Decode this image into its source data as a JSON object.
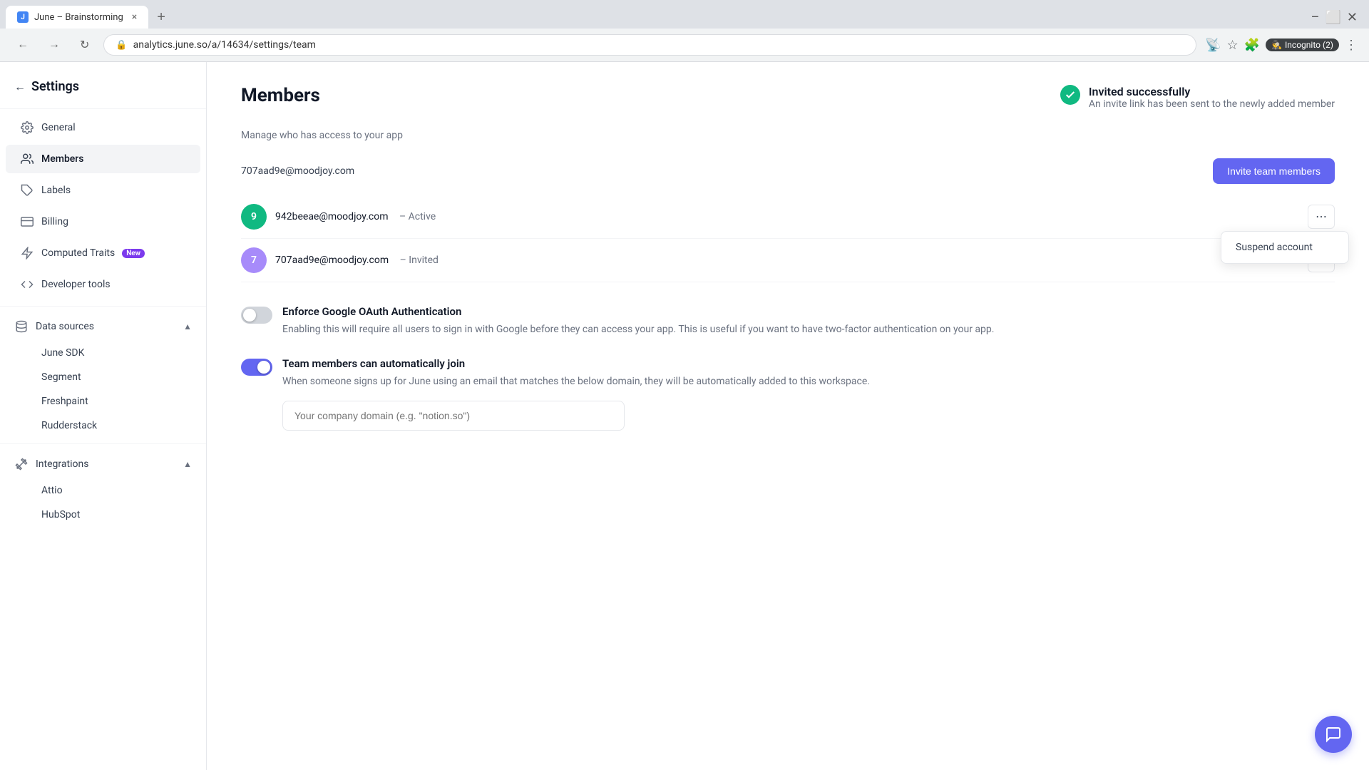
{
  "browser": {
    "tab_title": "June – Brainstorming",
    "tab_close": "×",
    "tab_new": "+",
    "nav_back": "←",
    "nav_forward": "→",
    "nav_refresh": "↻",
    "address": "analytics.june.so/a/14634/settings/team",
    "incognito_label": "Incognito (2)"
  },
  "sidebar": {
    "back_label": "←",
    "title": "Settings",
    "items": [
      {
        "id": "general",
        "label": "General",
        "icon": "gear"
      },
      {
        "id": "members",
        "label": "Members",
        "icon": "users",
        "active": true
      },
      {
        "id": "labels",
        "label": "Labels",
        "icon": "tag"
      },
      {
        "id": "billing",
        "label": "Billing",
        "icon": "credit-card"
      },
      {
        "id": "computed-traits",
        "label": "Computed Traits",
        "icon": "sparkle",
        "badge": "New"
      },
      {
        "id": "developer-tools",
        "label": "Developer tools",
        "icon": "code"
      }
    ],
    "groups": [
      {
        "id": "data-sources",
        "label": "Data sources",
        "icon": "database",
        "expanded": true,
        "sub_items": [
          "June SDK",
          "Segment",
          "Freshpaint",
          "Rudderstack"
        ]
      },
      {
        "id": "integrations",
        "label": "Integrations",
        "icon": "plug",
        "expanded": true,
        "sub_items": [
          "Attio",
          "HubSpot"
        ]
      }
    ]
  },
  "page": {
    "title": "Members",
    "subtitle": "Manage who has access to your app"
  },
  "success_toast": {
    "title": "Invited successfully",
    "message": "An invite link has been sent to the newly added member"
  },
  "invite_button_label": "Invite team members",
  "members": [
    {
      "email": "707aad9e@moodjoy.com",
      "status": "",
      "avatar_letter": "",
      "avatar_color": ""
    },
    {
      "email": "942beeae@moodjoy.com",
      "status": "Active",
      "avatar_letter": "9",
      "avatar_color": "#10b981"
    },
    {
      "email": "707aad9e@moodjoy.com",
      "status": "Invited",
      "avatar_letter": "7",
      "avatar_color": "#a78bfa"
    }
  ],
  "context_menu": {
    "items": [
      "Suspend account"
    ]
  },
  "toggles": [
    {
      "id": "google-oauth",
      "state": "off",
      "title": "Enforce Google OAuth Authentication",
      "description": "Enabling this will require all users to sign in with Google before they can access your app. This is useful if you want to have two-factor authentication on your app."
    },
    {
      "id": "auto-join",
      "state": "on",
      "title": "Team members can automatically join",
      "description": "When someone signs up for June using an email that matches the below domain, they will be automatically added to this workspace."
    }
  ],
  "domain_input": {
    "placeholder": "Your company domain (e.g. \"notion.so\")"
  },
  "colors": {
    "accent": "#6366f1",
    "success": "#10b981"
  }
}
